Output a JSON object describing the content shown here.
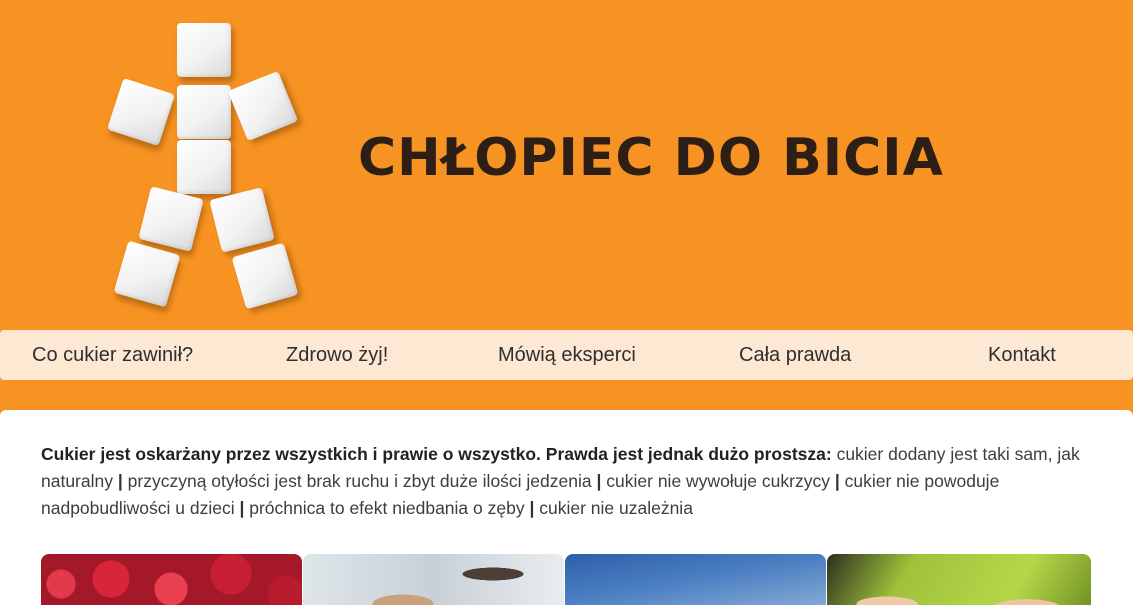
{
  "header": {
    "site_title": "CHŁOPIEC DO BICIA",
    "logo_name": "sugar-cube-boy-logo"
  },
  "nav": {
    "items": [
      {
        "label": "Co cukier zawinił?"
      },
      {
        "label": "Zdrowo żyj!"
      },
      {
        "label": "Mówią eksperci"
      },
      {
        "label": "Cała prawda"
      },
      {
        "label": "Kontakt"
      }
    ]
  },
  "main": {
    "intro_bold": "Cukier jest oskarżany przez wszystkich i prawie o wszystko. Prawda jest jednak dużo prostsza:",
    "separator": "|",
    "facts": [
      "cukier dodany jest taki sam, jak naturalny",
      "przyczyną otyłości jest brak ruchu i zbyt duże ilości jedzenia",
      "cukier nie wywołuje cukrzycy",
      "cukier nie powoduje nadpobudliwości u dzieci",
      "próchnica to efekt niedbania o zęby",
      "cukier nie uzależnia"
    ]
  },
  "colors": {
    "brand_orange": "#f79322",
    "nav_bg": "#fde8d4",
    "title_dark": "#2d1e16"
  }
}
